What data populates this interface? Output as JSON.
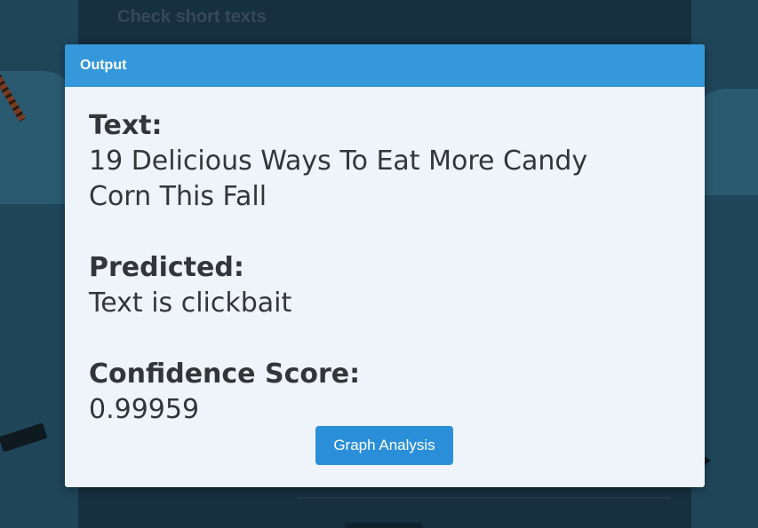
{
  "background": {
    "page_title": "Check short texts"
  },
  "modal": {
    "title": "Output",
    "text_label": "Text:",
    "text_value": "19 Delicious Ways To Eat More Candy Corn This Fall",
    "predicted_label": "Predicted:",
    "predicted_value": "Text is clickbait",
    "confidence_label": "Confidence Score:",
    "confidence_value": "0.99959",
    "graph_button_label": "Graph Analysis"
  },
  "colors": {
    "header": "#3498db",
    "button": "#2a8fd8",
    "modal_bg": "#eef4fa",
    "text": "#333639"
  }
}
